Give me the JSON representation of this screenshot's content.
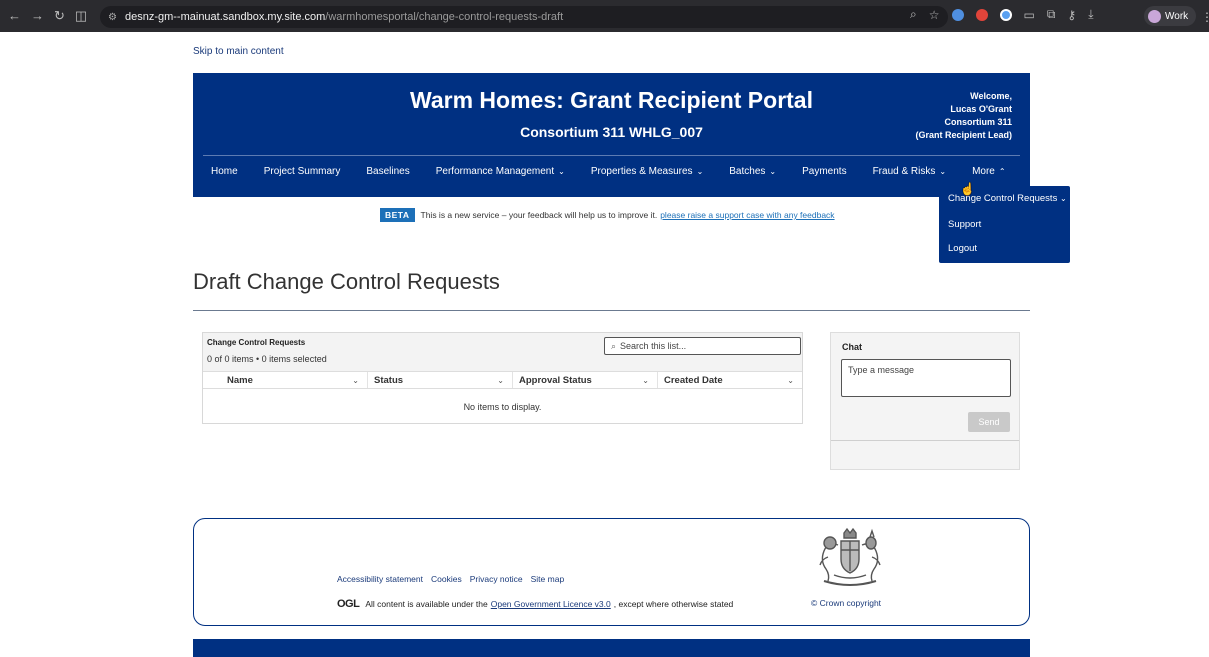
{
  "browser": {
    "url_host": "desnz-gm--mainuat.sandbox.my.site.com",
    "url_path": "/warmhomesportal/change-control-requests-draft",
    "profile_label": "Work"
  },
  "skip_link": "Skip to main content",
  "header": {
    "title": "Warm Homes: Grant Recipient Portal",
    "subtitle": "Consortium 311 WHLG_007",
    "welcome_lines": [
      "Welcome,",
      "Lucas O'Grant",
      "Consortium 311",
      "(Grant Recipient Lead)"
    ]
  },
  "nav": {
    "items": [
      {
        "label": "Home",
        "dropdown": false
      },
      {
        "label": "Project Summary",
        "dropdown": false
      },
      {
        "label": "Baselines",
        "dropdown": false
      },
      {
        "label": "Performance Management",
        "dropdown": true
      },
      {
        "label": "Properties & Measures",
        "dropdown": true
      },
      {
        "label": "Batches",
        "dropdown": true
      },
      {
        "label": "Payments",
        "dropdown": false
      },
      {
        "label": "Fraud & Risks",
        "dropdown": true
      },
      {
        "label": "More",
        "dropdown": true
      }
    ],
    "more_menu": [
      "Change Control Requests",
      "Support",
      "Logout"
    ]
  },
  "beta": {
    "tag": "BETA",
    "text": "This is a new service – your feedback will help us to improve it.",
    "link": "please raise a support case with any feedback"
  },
  "page_title": "Draft Change Control Requests",
  "list": {
    "title": "Change Control Requests",
    "count": "0 of 0 items • 0 items selected",
    "search_placeholder": "Search this list...",
    "columns": [
      "Name",
      "Status",
      "Approval Status",
      "Created Date"
    ],
    "empty": "No items to display."
  },
  "chat": {
    "title": "Chat",
    "placeholder": "Type a message",
    "send": "Send"
  },
  "footer": {
    "links": [
      "Accessibility statement",
      "Cookies",
      "Privacy notice",
      "Site map"
    ],
    "ogl_logo": "OGL",
    "ogl_text_pre": "All content is available under the",
    "ogl_link": "Open Government Licence v3.0",
    "ogl_text_post": ", except where otherwise stated",
    "copyright": "© Crown copyright"
  },
  "colors": {
    "brand_navy": "#003082",
    "beta_blue": "#1d70b8"
  }
}
